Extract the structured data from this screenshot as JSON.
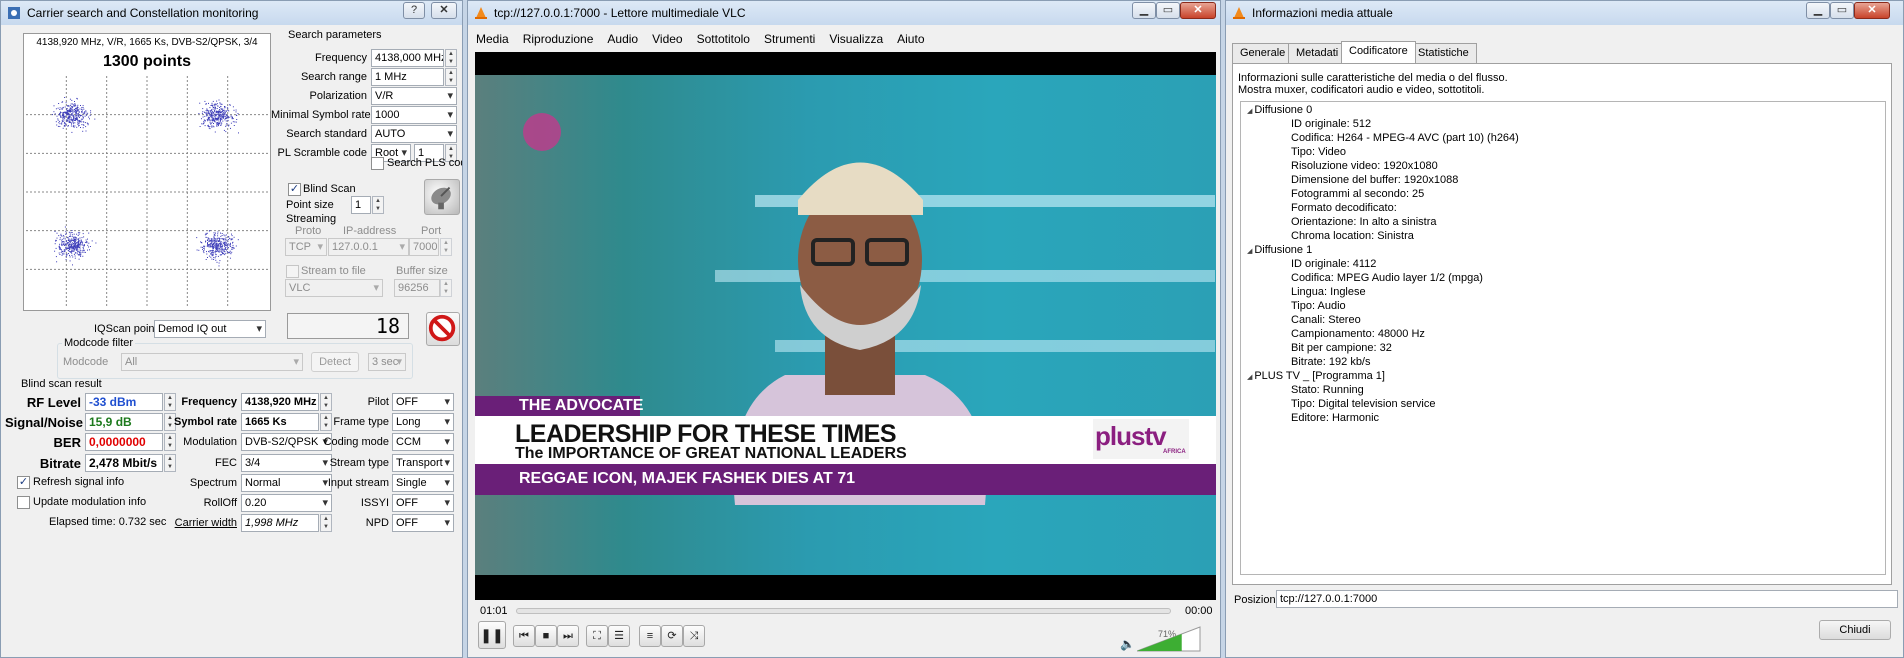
{
  "carrier": {
    "title": "Carrier search and Constellation monitoring",
    "help_btn": "?",
    "close_btn": "✕",
    "constellation_header": "4138,920 MHz, V/R, 1665 Ks, DVB-S2/QPSK, 3/4",
    "points": "1300 points",
    "search_params_label": "Search parameters",
    "frequency_label": "Frequency",
    "frequency_value": "4138,000 MHz",
    "search_range_label": "Search range",
    "search_range_value": "1 MHz",
    "polarization_label": "Polarization",
    "polarization_value": "V/R",
    "min_symbol_rate_label": "Minimal Symbol rate",
    "min_symbol_rate_value": "1000",
    "search_standard_label": "Search standard",
    "search_standard_value": "AUTO",
    "pl_scramble_label": "PL Scramble code",
    "pl_scramble_mode": "Root",
    "pl_scramble_value": "1",
    "search_pls_label": "Search PLS code",
    "blind_scan_label": "Blind Scan",
    "point_size_label": "Point size",
    "point_size_value": "1",
    "streaming_label": "Streaming",
    "proto_label": "Proto",
    "ip_label": "IP-address",
    "port_label": "Port",
    "proto_value": "TCP",
    "ip_value": "127.0.0.1",
    "port_value": "7000",
    "stream_to_file_label": "Stream to file",
    "buffer_size_label": "Buffer size",
    "file_format_value": "VLC",
    "buffer_size_value": "96256",
    "iqscan_label": "IQScan point",
    "iqscan_value": "Demod IQ out",
    "display_value": "18",
    "modcode_filter_label": "Modcode filter",
    "modcode_label": "Modcode",
    "modcode_value": "All",
    "detect_btn": "Detect",
    "sec_value": "3 sec",
    "blind_scan_result_label": "Blind scan result",
    "rf_level_label": "RF Level",
    "rf_level_value": "-33 dBm",
    "signal_noise_label": "Signal/Noise",
    "signal_noise_value": "15,9 dB",
    "ber_label": "BER",
    "ber_value": "0,0000000",
    "bitrate_label": "Bitrate",
    "bitrate_value": "2,478 Mbit/s",
    "res_frequency_label": "Frequency",
    "res_frequency_value": "4138,920 MHz",
    "res_symbol_rate_label": "Symbol rate",
    "res_symbol_rate_value": "1665 Ks",
    "modulation_label": "Modulation",
    "modulation_value": "DVB-S2/QPSK",
    "fec_label": "FEC",
    "fec_value": "3/4",
    "spectrum_label": "Spectrum",
    "spectrum_value": "Normal",
    "rolloff_label": "RollOff",
    "rolloff_value": "0.20",
    "carrier_width_label": "Carrier width",
    "carrier_width_value": "1,998 MHz",
    "pilot_label": "Pilot",
    "pilot_value": "OFF",
    "frame_type_label": "Frame type",
    "frame_type_value": "Long",
    "coding_mode_label": "Coding mode",
    "coding_mode_value": "CCM",
    "stream_type_label": "Stream type",
    "stream_type_value": "Transport",
    "input_stream_label": "Input stream",
    "input_stream_value": "Single",
    "issyi_label": "ISSYI",
    "issyi_value": "OFF",
    "npd_label": "NPD",
    "npd_value": "OFF",
    "refresh_label": "Refresh signal info",
    "update_mod_label": "Update modulation info",
    "elapsed_label": "Elapsed time: 0.732 sec"
  },
  "vlc": {
    "title": "tcp://127.0.0.1:7000 - Lettore multimediale VLC",
    "menu": [
      "Media",
      "Riproduzione",
      "Audio",
      "Video",
      "Sottotitolo",
      "Strumenti",
      "Visualizza",
      "Aiuto"
    ],
    "lower_third_tag": "THE ADVOCATE",
    "headline": "LEADERSHIP FOR THESE TIMES",
    "subheadline": "The IMPORTANCE OF GREAT NATIONAL LEADERS",
    "ticker": "REGGAE ICON, MAJEK FASHEK DIES AT 71",
    "logo_text": "plustv",
    "logo_sub": "AFRICA",
    "time_elapsed": "01:01",
    "time_total": "00:00",
    "volume": "71%",
    "volume_level": 0.71
  },
  "info": {
    "title": "Informazioni media attuale",
    "tabs": [
      "Generale",
      "Metadati",
      "Codificatore",
      "Statistiche"
    ],
    "description_line1": "Informazioni sulle caratteristiche del media o del flusso.",
    "description_line2": "Mostra muxer, codificatori audio e video, sottotitoli.",
    "tree": [
      {
        "text": "Diffusione 0",
        "level": 0
      },
      {
        "text": "ID originale: 512",
        "level": 1
      },
      {
        "text": "Codifica: H264 - MPEG-4 AVC (part 10) (h264)",
        "level": 1
      },
      {
        "text": "Tipo: Video",
        "level": 1
      },
      {
        "text": "Risoluzione video: 1920x1080",
        "level": 1
      },
      {
        "text": "Dimensione del buffer: 1920x1088",
        "level": 1
      },
      {
        "text": "Fotogrammi al secondo: 25",
        "level": 1
      },
      {
        "text": "Formato decodificato:",
        "level": 1
      },
      {
        "text": "Orientazione: In alto a sinistra",
        "level": 1
      },
      {
        "text": "Chroma location: Sinistra",
        "level": 1
      },
      {
        "text": "Diffusione 1",
        "level": 0
      },
      {
        "text": "ID originale: 4112",
        "level": 1
      },
      {
        "text": "Codifica: MPEG Audio layer 1/2 (mpga)",
        "level": 1
      },
      {
        "text": "Lingua: Inglese",
        "level": 1
      },
      {
        "text": "Tipo: Audio",
        "level": 1
      },
      {
        "text": "Canali: Stereo",
        "level": 1
      },
      {
        "text": "Campionamento: 48000 Hz",
        "level": 1
      },
      {
        "text": "Bit per campione: 32",
        "level": 1
      },
      {
        "text": "Bitrate: 192 kb/s",
        "level": 1
      },
      {
        "text": "PLUS TV      _ [Programma 1]",
        "level": 0
      },
      {
        "text": "Stato: Running",
        "level": 1
      },
      {
        "text": "Tipo: Digital television service",
        "level": 1
      },
      {
        "text": "Editore: Harmonic",
        "level": 1
      }
    ],
    "position_label": "Posizione:",
    "position_value": "tcp://127.0.0.1:7000",
    "close_btn": "Chiudi"
  },
  "colors": {
    "rf_level": "#1f4fd0",
    "signal_noise": "#1d7a1d",
    "ber": "#e00000",
    "tv_purple": "#6a1f78",
    "vlc_progress": "#3dae33"
  }
}
